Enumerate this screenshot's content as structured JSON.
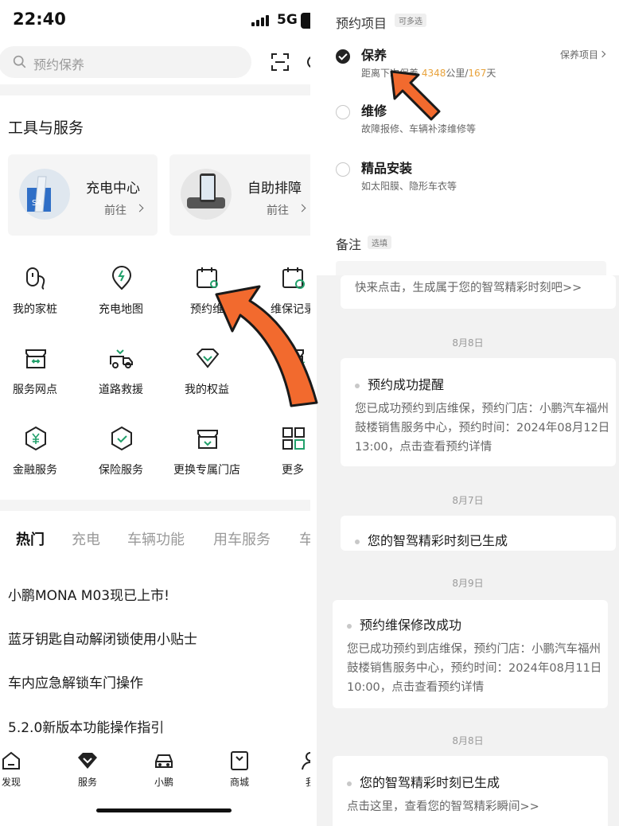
{
  "status_bar": {
    "time": "22:40",
    "network": "5G"
  },
  "search": {
    "placeholder": "预约保养"
  },
  "tools": {
    "title": "工具与服务",
    "cards": [
      {
        "title": "充电中心",
        "link": "前往"
      },
      {
        "title": "自助排障",
        "link": "前往"
      }
    ],
    "grid": [
      {
        "label": "我的家桩",
        "icon": "home-charger-icon"
      },
      {
        "label": "充电地图",
        "icon": "charge-map-icon"
      },
      {
        "label": "预约维",
        "icon": "calendar-wrench-icon"
      },
      {
        "label": "维保记录",
        "icon": "calendar-check-icon"
      },
      {
        "label": "服务网点",
        "icon": "store-icon"
      },
      {
        "label": "道路救援",
        "icon": "tow-truck-icon"
      },
      {
        "label": "我的权益",
        "icon": "diamond-icon"
      },
      {
        "label": "",
        "icon": "store-star-icon"
      },
      {
        "label": "金融服务",
        "icon": "yen-shield-icon"
      },
      {
        "label": "保险服务",
        "icon": "shield-check-icon"
      },
      {
        "label": "更换专属门店",
        "icon": "store-swap-icon"
      },
      {
        "label": "更多",
        "icon": "grid-icon"
      }
    ]
  },
  "tabs": [
    {
      "label": "热门",
      "active": true
    },
    {
      "label": "充电"
    },
    {
      "label": "车辆功能"
    },
    {
      "label": "用车服务"
    },
    {
      "label": "车"
    }
  ],
  "articles": [
    "小鹏MONA M03现已上市!",
    "蓝牙钥匙自动解闭锁使用小贴士",
    "车内应急解锁车门操作",
    "5.2.0新版本功能操作指引"
  ],
  "bottom_nav": [
    {
      "label": "发现",
      "icon": "home-icon"
    },
    {
      "label": "服务",
      "icon": "service-diamond-icon"
    },
    {
      "label": "小鹏",
      "icon": "car-icon"
    },
    {
      "label": "商城",
      "icon": "bag-icon"
    },
    {
      "label": "我",
      "icon": "person-icon"
    }
  ],
  "appointment": {
    "title": "预约项目",
    "tag": "可多选",
    "options": [
      {
        "name": "保养",
        "desc_prefix": "距离下次保养 ",
        "distance": "4348",
        "desc_mid": "公里/",
        "days": "167",
        "desc_suffix": "天",
        "link": "保养项目",
        "checked": true
      },
      {
        "name": "维修",
        "desc": "故障报修、车辆补漆维修等",
        "checked": false
      },
      {
        "name": "精品安装",
        "desc": "如太阳膜、隐形车衣等",
        "checked": false
      }
    ],
    "remark_label": "备注",
    "remark_tag": "选填"
  },
  "messages": {
    "top_partial": "快来点击，生成属于您的智驾精彩时刻吧>>",
    "items": [
      {
        "date": "8月8日",
        "title": "预约成功提醒",
        "body": "您已成功预约到店维保，预约门店：小鹏汽车福州鼓楼销售服务中心，预约时间：2024年08月12日 13:00，点击查看预约详情"
      },
      {
        "date": "8月7日",
        "title": "您的智驾精彩时刻已生成"
      },
      {
        "date": "8月9日",
        "title": "预约维保修改成功",
        "body": "您已成功预约到店维保，预约门店：小鹏汽车福州鼓楼销售服务中心，预约时间：2024年08月11日 10:00，点击查看预约详情"
      },
      {
        "date": "8月8日",
        "title": "您的智驾精彩时刻已生成",
        "body": "点击这里，查看您的智驾精彩瞬间>>"
      }
    ]
  },
  "colors": {
    "arrow": "#f26a2e",
    "highlight": "#e8a33c"
  }
}
